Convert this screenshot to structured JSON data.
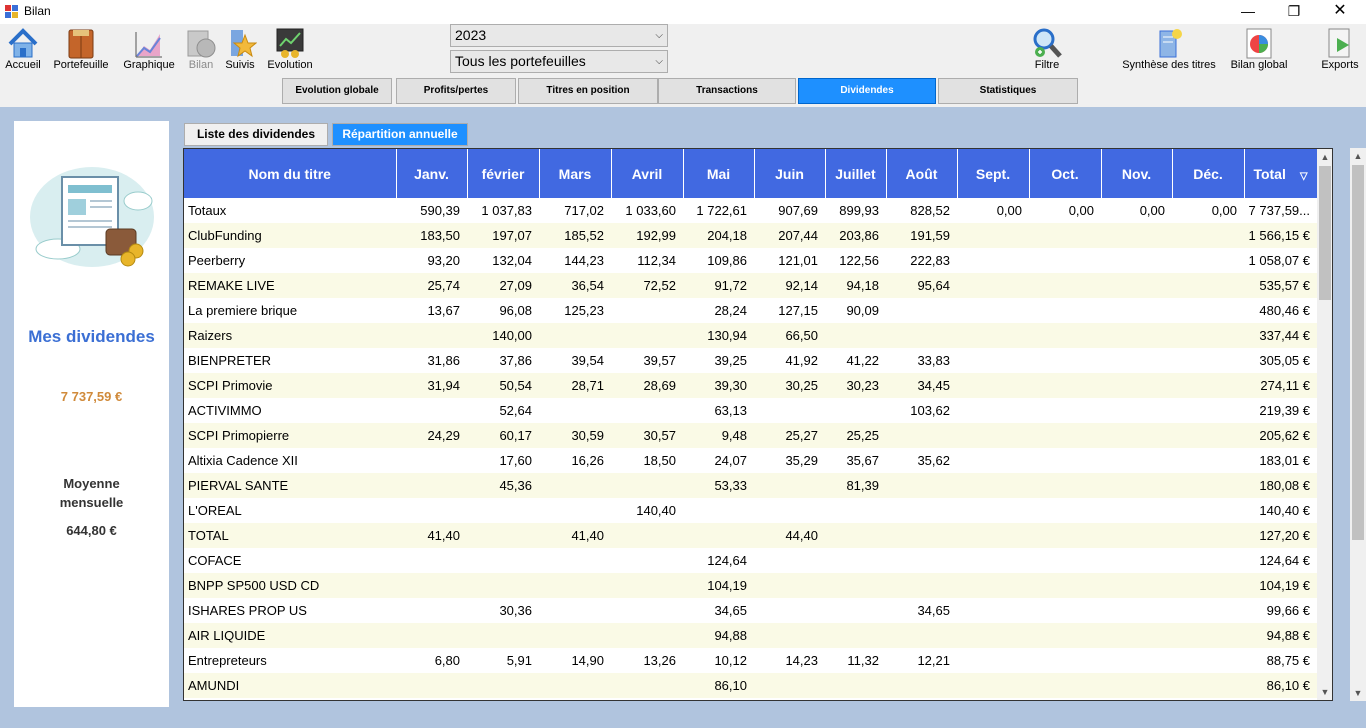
{
  "window": {
    "title": "Bilan"
  },
  "toolbar": {
    "accueil": "Accueil",
    "portefeuille": "Portefeuille",
    "graphique": "Graphique",
    "bilan": "Bilan",
    "suivis": "Suivis",
    "evolution": "Evolution",
    "filtre": "Filtre",
    "synthese": "Synthèse des titres",
    "bilan_global": "Bilan global",
    "exports": "Exports"
  },
  "filters": {
    "year": "2023",
    "portfolio": "Tous les portefeuilles"
  },
  "tabs": [
    "Evolution globale",
    "Profits/pertes",
    "Titres en position",
    "Transactions",
    "Dividendes",
    "Statistiques"
  ],
  "active_tab": "Dividendes",
  "subtabs": [
    "Liste des dividendes",
    "Répartition annuelle"
  ],
  "active_subtab": "Répartition annuelle",
  "summary": {
    "title": "Mes dividendes",
    "total": "7 737,59 €",
    "average_label": "Moyenne mensuelle",
    "average_value": "644,80 €"
  },
  "table": {
    "columns": [
      "Nom du titre",
      "Janv.",
      "février",
      "Mars",
      "Avril",
      "Mai",
      "Juin",
      "Juillet",
      "Août",
      "Sept.",
      "Oct.",
      "Nov.",
      "Déc.",
      "Total"
    ],
    "sort_indicator": "▽",
    "rows": [
      [
        "Totaux",
        "590,39",
        "1 037,83",
        "717,02",
        "1 033,60",
        "1 722,61",
        "907,69",
        "899,93",
        "828,52",
        "0,00",
        "0,00",
        "0,00",
        "0,00",
        "7 737,59..."
      ],
      [
        "ClubFunding",
        "183,50",
        "197,07",
        "185,52",
        "192,99",
        "204,18",
        "207,44",
        "203,86",
        "191,59",
        "",
        "",
        "",
        "",
        "1 566,15 €"
      ],
      [
        "Peerberry",
        "93,20",
        "132,04",
        "144,23",
        "112,34",
        "109,86",
        "121,01",
        "122,56",
        "222,83",
        "",
        "",
        "",
        "",
        "1 058,07 €"
      ],
      [
        "REMAKE LIVE",
        "25,74",
        "27,09",
        "36,54",
        "72,52",
        "91,72",
        "92,14",
        "94,18",
        "95,64",
        "",
        "",
        "",
        "",
        "535,57 €"
      ],
      [
        "La premiere brique",
        "13,67",
        "96,08",
        "125,23",
        "",
        "28,24",
        "127,15",
        "90,09",
        "",
        "",
        "",
        "",
        "",
        "480,46 €"
      ],
      [
        "Raizers",
        "",
        "140,00",
        "",
        "",
        "130,94",
        "66,50",
        "",
        "",
        "",
        "",
        "",
        "",
        "337,44 €"
      ],
      [
        "BIENPRETER",
        "31,86",
        "37,86",
        "39,54",
        "39,57",
        "39,25",
        "41,92",
        "41,22",
        "33,83",
        "",
        "",
        "",
        "",
        "305,05 €"
      ],
      [
        "SCPI Primovie",
        "31,94",
        "50,54",
        "28,71",
        "28,69",
        "39,30",
        "30,25",
        "30,23",
        "34,45",
        "",
        "",
        "",
        "",
        "274,11 €"
      ],
      [
        "ACTIVIMMO",
        "",
        "52,64",
        "",
        "",
        "63,13",
        "",
        "",
        "103,62",
        "",
        "",
        "",
        "",
        "219,39 €"
      ],
      [
        "SCPI Primopierre",
        "24,29",
        "60,17",
        "30,59",
        "30,57",
        "9,48",
        "25,27",
        "25,25",
        "",
        "",
        "",
        "",
        "",
        "205,62 €"
      ],
      [
        "Altixia Cadence XII",
        "",
        "17,60",
        "16,26",
        "18,50",
        "24,07",
        "35,29",
        "35,67",
        "35,62",
        "",
        "",
        "",
        "",
        "183,01 €"
      ],
      [
        "PIERVAL SANTE",
        "",
        "45,36",
        "",
        "",
        "53,33",
        "",
        "81,39",
        "",
        "",
        "",
        "",
        "",
        "180,08 €"
      ],
      [
        "L'OREAL",
        "",
        "",
        "",
        "140,40",
        "",
        "",
        "",
        "",
        "",
        "",
        "",
        "",
        "140,40 €"
      ],
      [
        "TOTAL",
        "41,40",
        "",
        "41,40",
        "",
        "",
        "44,40",
        "",
        "",
        "",
        "",
        "",
        "",
        "127,20 €"
      ],
      [
        "COFACE",
        "",
        "",
        "",
        "",
        "124,64",
        "",
        "",
        "",
        "",
        "",
        "",
        "",
        "124,64 €"
      ],
      [
        "BNPP SP500 USD CD",
        "",
        "",
        "",
        "",
        "104,19",
        "",
        "",
        "",
        "",
        "",
        "",
        "",
        "104,19 €"
      ],
      [
        "ISHARES PROP US",
        "",
        "30,36",
        "",
        "",
        "34,65",
        "",
        "",
        "34,65",
        "",
        "",
        "",
        "",
        "99,66 €"
      ],
      [
        "AIR LIQUIDE",
        "",
        "",
        "",
        "",
        "94,88",
        "",
        "",
        "",
        "",
        "",
        "",
        "",
        "94,88 €"
      ],
      [
        "Entrepreteurs",
        "6,80",
        "5,91",
        "14,90",
        "13,26",
        "10,12",
        "14,23",
        "11,32",
        "12,21",
        "",
        "",
        "",
        "",
        "88,75 €"
      ],
      [
        "AMUNDI",
        "",
        "",
        "",
        "",
        "86,10",
        "",
        "",
        "",
        "",
        "",
        "",
        "",
        "86,10 €"
      ]
    ]
  }
}
